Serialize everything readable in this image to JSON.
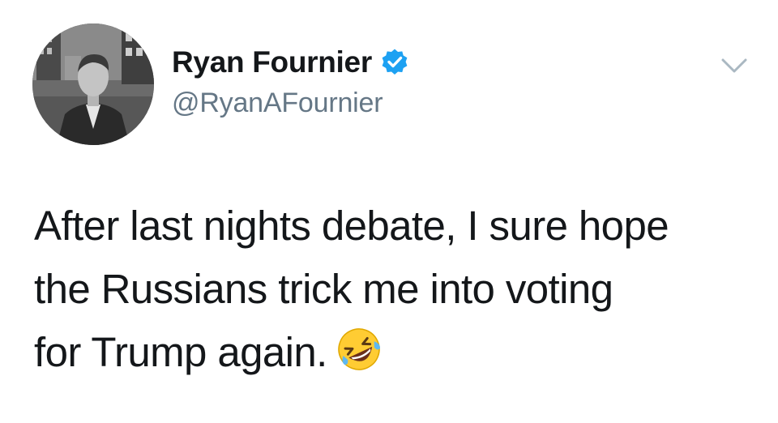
{
  "tweet": {
    "author": {
      "display_name": "Ryan Fournier",
      "handle": "@RyanAFournier",
      "verified": true,
      "avatar_icon": "profile-photo"
    },
    "text_lines": [
      "After last nights debate, I sure hope",
      "the Russians trick me into voting",
      "for Trump again."
    ],
    "emoji": "rolling-on-the-floor-laughing-icon",
    "menu_icon": "chevron-down-icon"
  },
  "colors": {
    "text": "#14171a",
    "secondary_text": "#657786",
    "verified_blue": "#1da1f2",
    "emoji_yellow": "#ffcc33",
    "chevron": "#aab8c2"
  }
}
